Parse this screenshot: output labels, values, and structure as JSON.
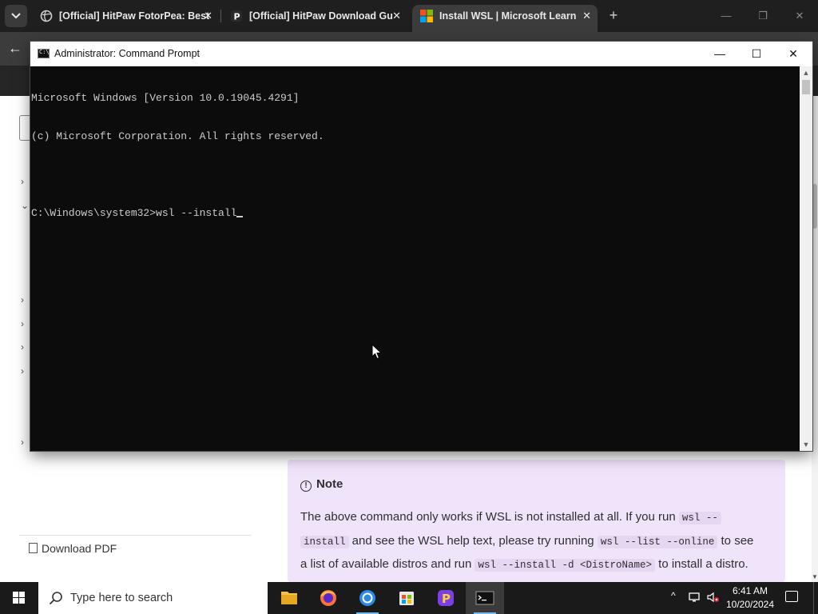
{
  "browser": {
    "tabs": [
      {
        "title": "[Official] HitPaw FotorPea: Best",
        "active": false
      },
      {
        "title": "[Official] HitPaw Download Gu",
        "active": false
      },
      {
        "title": "Install WSL | Microsoft Learn",
        "active": true
      }
    ],
    "tab_close_glyph": "✕",
    "new_tab_glyph": "+",
    "window_controls": {
      "minimize": "—",
      "restore": "❐",
      "close": "✕"
    },
    "back_glyph": "←"
  },
  "webpage": {
    "sidebar_download_pdf": "Download PDF",
    "note": {
      "heading": "Note",
      "line1_text_a": "The above command only works if WSL is not installed at all. If you run ",
      "code_wsl": "wsl --",
      "code_install": "install",
      "line2_text_a": " and see the WSL help text, please try running ",
      "code_list_online": "wsl --list --online",
      "line2_text_b": " to see",
      "line3_text_a": "a list of available distros and run ",
      "code_install_d": "wsl --install -d <DistroName>",
      "line3_text_b": " to install a distro."
    }
  },
  "cmd": {
    "title": "Administrator: Command Prompt",
    "controls": {
      "minimize": "—",
      "maximize": "☐",
      "close": "✕"
    },
    "lines": [
      "Microsoft Windows [Version 10.0.19045.4291]",
      "(c) Microsoft Corporation. All rights reserved.",
      "",
      "C:\\Windows\\system32>wsl --install"
    ]
  },
  "taskbar": {
    "search_placeholder": "Type here to search",
    "clock_time": "6:41 AM",
    "clock_date": "10/20/2024",
    "tray_chevron": "^"
  },
  "colors": {
    "note_background": "#f0e4fb",
    "console_background": "#0c0c0c",
    "console_text": "#cccccc",
    "taskbar": "#1a1a1a"
  }
}
